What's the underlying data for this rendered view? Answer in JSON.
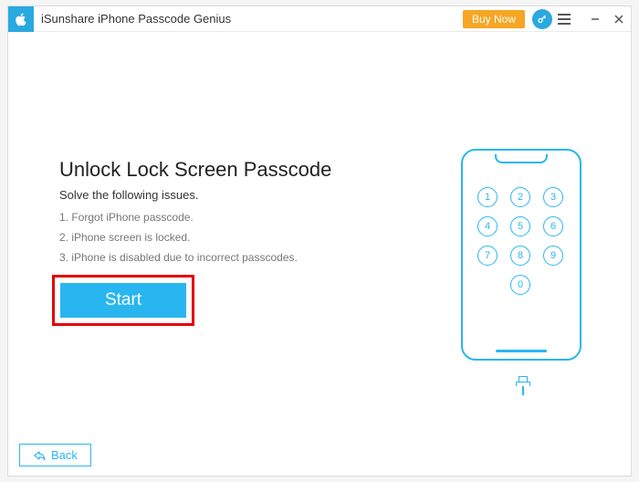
{
  "titlebar": {
    "app_title": "iSunshare iPhone Passcode Genius",
    "buy_now": "Buy Now"
  },
  "main": {
    "heading": "Unlock Lock Screen Passcode",
    "subheading": "Solve the following issues.",
    "issues": [
      "1. Forgot iPhone passcode.",
      "2. iPhone screen is locked.",
      "3. iPhone is disabled due to incorrect passcodes."
    ],
    "start_label": "Start"
  },
  "keypad": [
    "1",
    "2",
    "3",
    "4",
    "5",
    "6",
    "7",
    "8",
    "9",
    "0"
  ],
  "footer": {
    "back_label": "Back"
  },
  "colors": {
    "accent": "#29b6f0",
    "highlight_border": "#e40000",
    "buy_now_bg": "#f6a623"
  }
}
